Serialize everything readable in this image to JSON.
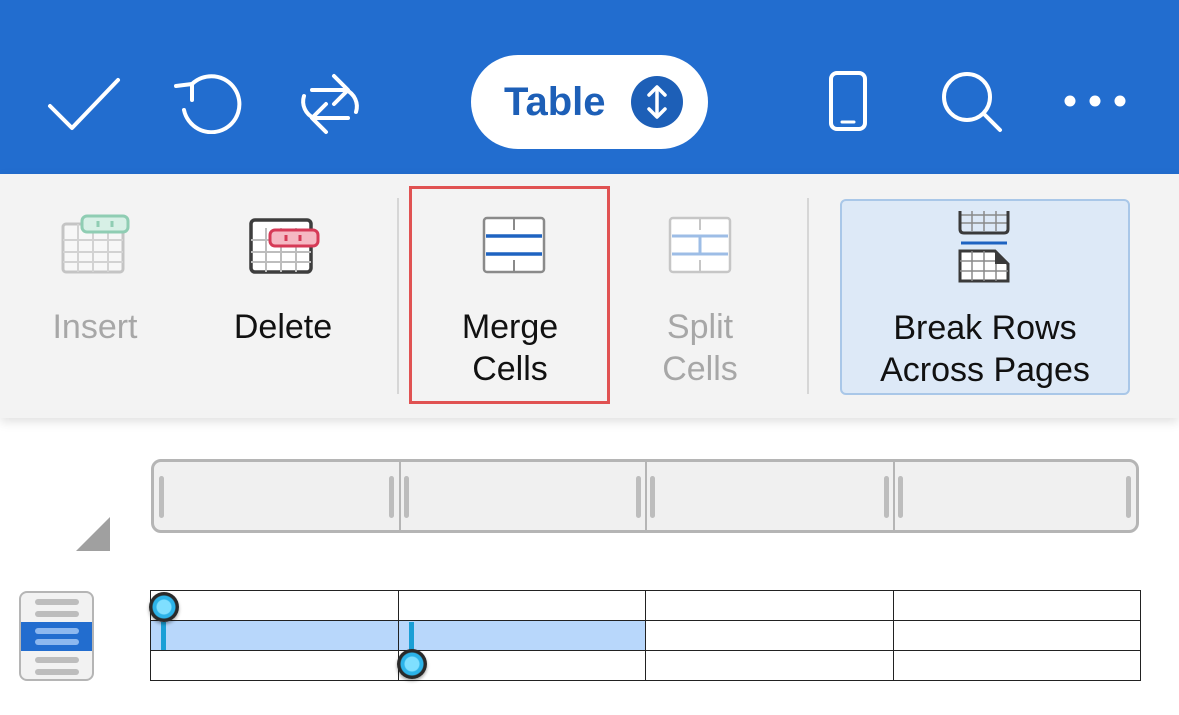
{
  "toolbar": {
    "icons": [
      "checkmark-icon",
      "undo-icon",
      "sync-icon",
      "phone-icon",
      "search-icon",
      "more-icon"
    ],
    "mode_label": "Table",
    "accent_color": "#226dcf"
  },
  "ribbon": {
    "buttons": [
      {
        "id": "insert",
        "label": "Insert",
        "icon": "insert-table-icon",
        "enabled": false
      },
      {
        "id": "delete",
        "label": "Delete",
        "icon": "delete-table-icon",
        "enabled": true
      },
      {
        "id": "merge",
        "label_line1": "Merge",
        "label_line2": "Cells",
        "icon": "merge-cells-icon",
        "enabled": true,
        "highlighted": true
      },
      {
        "id": "split",
        "label_line1": "Split",
        "label_line2": "Cells",
        "icon": "split-cells-icon",
        "enabled": false
      },
      {
        "id": "break",
        "label_line1": "Break Rows",
        "label_line2": "Across Pages",
        "icon": "break-rows-icon",
        "enabled": true,
        "active": true
      }
    ],
    "highlight_color": "#e05252"
  },
  "document": {
    "table": {
      "rows": 3,
      "columns": 4,
      "selected_row": 2,
      "selected_columns": [
        1,
        2
      ],
      "selection_color": "#b8d7fb"
    }
  }
}
